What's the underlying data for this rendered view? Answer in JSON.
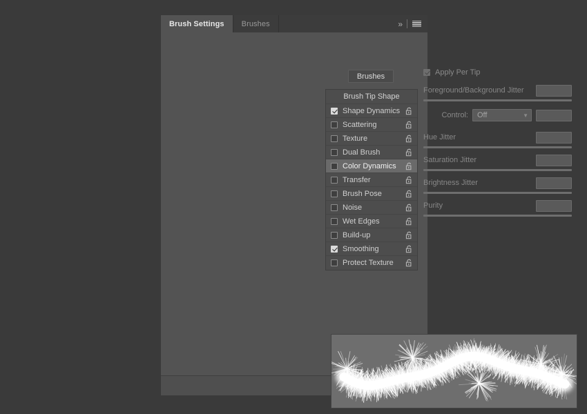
{
  "app": {
    "panel_title": "Brush Settings"
  },
  "tabs": [
    {
      "label": "Brush Settings",
      "active": true
    },
    {
      "label": "Brushes",
      "active": false
    }
  ],
  "tab_tools": {
    "expand_icon": "chevron-double-right-icon",
    "expand_glyph": "»",
    "menu_icon": "panel-menu-icon"
  },
  "brushes_button": {
    "label": "Brushes"
  },
  "option_list": {
    "header": "Brush Tip Shape",
    "items": [
      {
        "label": "Shape Dynamics",
        "checked": true,
        "selected": false,
        "locked": false
      },
      {
        "label": "Scattering",
        "checked": false,
        "selected": false,
        "locked": false
      },
      {
        "label": "Texture",
        "checked": false,
        "selected": false,
        "locked": false
      },
      {
        "label": "Dual Brush",
        "checked": false,
        "selected": false,
        "locked": false
      },
      {
        "label": "Color Dynamics",
        "checked": false,
        "selected": true,
        "locked": false
      },
      {
        "label": "Transfer",
        "checked": false,
        "selected": false,
        "locked": false
      },
      {
        "label": "Brush Pose",
        "checked": false,
        "selected": false,
        "locked": false
      },
      {
        "label": "Noise",
        "checked": false,
        "selected": false,
        "locked": false
      },
      {
        "label": "Wet Edges",
        "checked": false,
        "selected": false,
        "locked": false
      },
      {
        "label": "Build-up",
        "checked": false,
        "selected": false,
        "locked": false
      },
      {
        "label": "Smoothing",
        "checked": true,
        "selected": false,
        "locked": false
      },
      {
        "label": "Protect Texture",
        "checked": false,
        "selected": false,
        "locked": false
      }
    ]
  },
  "controls": {
    "apply_per_tip": {
      "label": "Apply Per Tip",
      "checked": true,
      "enabled": false
    },
    "fg_bg_jitter": {
      "label": "Foreground/Background Jitter",
      "value": "",
      "fill_percent": 0
    },
    "control": {
      "label": "Control:",
      "value": "Off",
      "extra_value": ""
    },
    "hue_jitter": {
      "label": "Hue Jitter",
      "value": "",
      "fill_percent": 0
    },
    "saturation_jitter": {
      "label": "Saturation Jitter",
      "value": "",
      "fill_percent": 0
    },
    "brightness_jitter": {
      "label": "Brightness Jitter",
      "value": "",
      "fill_percent": 0
    },
    "purity": {
      "label": "Purity",
      "value": "",
      "fill_percent": 0
    }
  },
  "preview": {
    "name": "brush-stroke-preview",
    "background_color": "#6e6e6e",
    "stroke_color": "#ffffff",
    "description": "fur/spiky white brush stroke wave"
  },
  "footer": {
    "buttons": [
      {
        "icon": "live-tip-preview-toggle-icon"
      },
      {
        "icon": "create-new-brush-icon"
      }
    ]
  },
  "colors": {
    "panel_bg": "#535353",
    "tabbar_bg": "#3c3c3c",
    "active_tab_bg": "#535353",
    "list_bg": "#4d4d4d",
    "selected_row_bg": "#6a6a6a",
    "text": "#cfcfcf",
    "disabled_text": "#878787",
    "canvas_bg": "#3a3a3a"
  }
}
